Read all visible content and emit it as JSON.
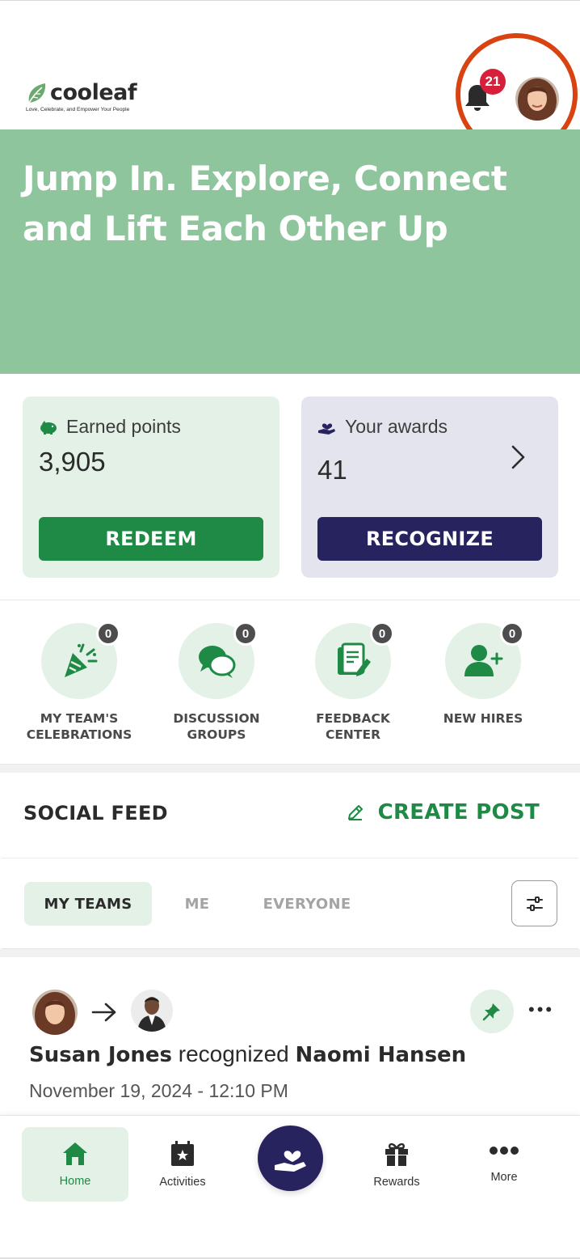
{
  "header": {
    "brand": "cooleaf",
    "tagline": "Love, Celebrate, and Empower Your People",
    "notification_count": "21"
  },
  "hero": {
    "line1": "Jump In. Explore, Connect",
    "line2": "and Lift Each Other Up"
  },
  "points_card": {
    "label": "Earned points",
    "value": "3,905",
    "button": "REDEEM"
  },
  "awards_card": {
    "label": "Your awards",
    "value": "41",
    "button": "RECOGNIZE"
  },
  "quick_actions": [
    {
      "line1": "MY TEAM'S",
      "line2": "CELEBRATIONS",
      "count": "0",
      "icon": "party-popper-icon"
    },
    {
      "line1": "DISCUSSION",
      "line2": "GROUPS",
      "count": "0",
      "icon": "chat-bubbles-icon"
    },
    {
      "line1": "FEEDBACK",
      "line2": "CENTER",
      "count": "0",
      "icon": "feedback-icon"
    },
    {
      "line1": "NEW HIRES",
      "line2": "",
      "count": "0",
      "icon": "add-user-icon"
    }
  ],
  "feed": {
    "title": "SOCIAL FEED",
    "create_post": "CREATE POST",
    "tabs": [
      "MY TEAMS",
      "ME",
      "EVERYONE"
    ],
    "active_tab": "MY TEAMS"
  },
  "post": {
    "sender": "Susan Jones",
    "action": "recognized",
    "recipient": "Naomi Hansen",
    "date": "November 19, 2024 - 12:10 PM"
  },
  "bottom_nav": {
    "items": [
      "Home",
      "Activities",
      "Rewards",
      "More"
    ],
    "active": "Home"
  },
  "colors": {
    "brand_green": "#1e8a45",
    "hero_green": "#8fc59c",
    "navy": "#27235f",
    "badge_red": "#d61f3a",
    "highlight_ring": "#d94312"
  }
}
